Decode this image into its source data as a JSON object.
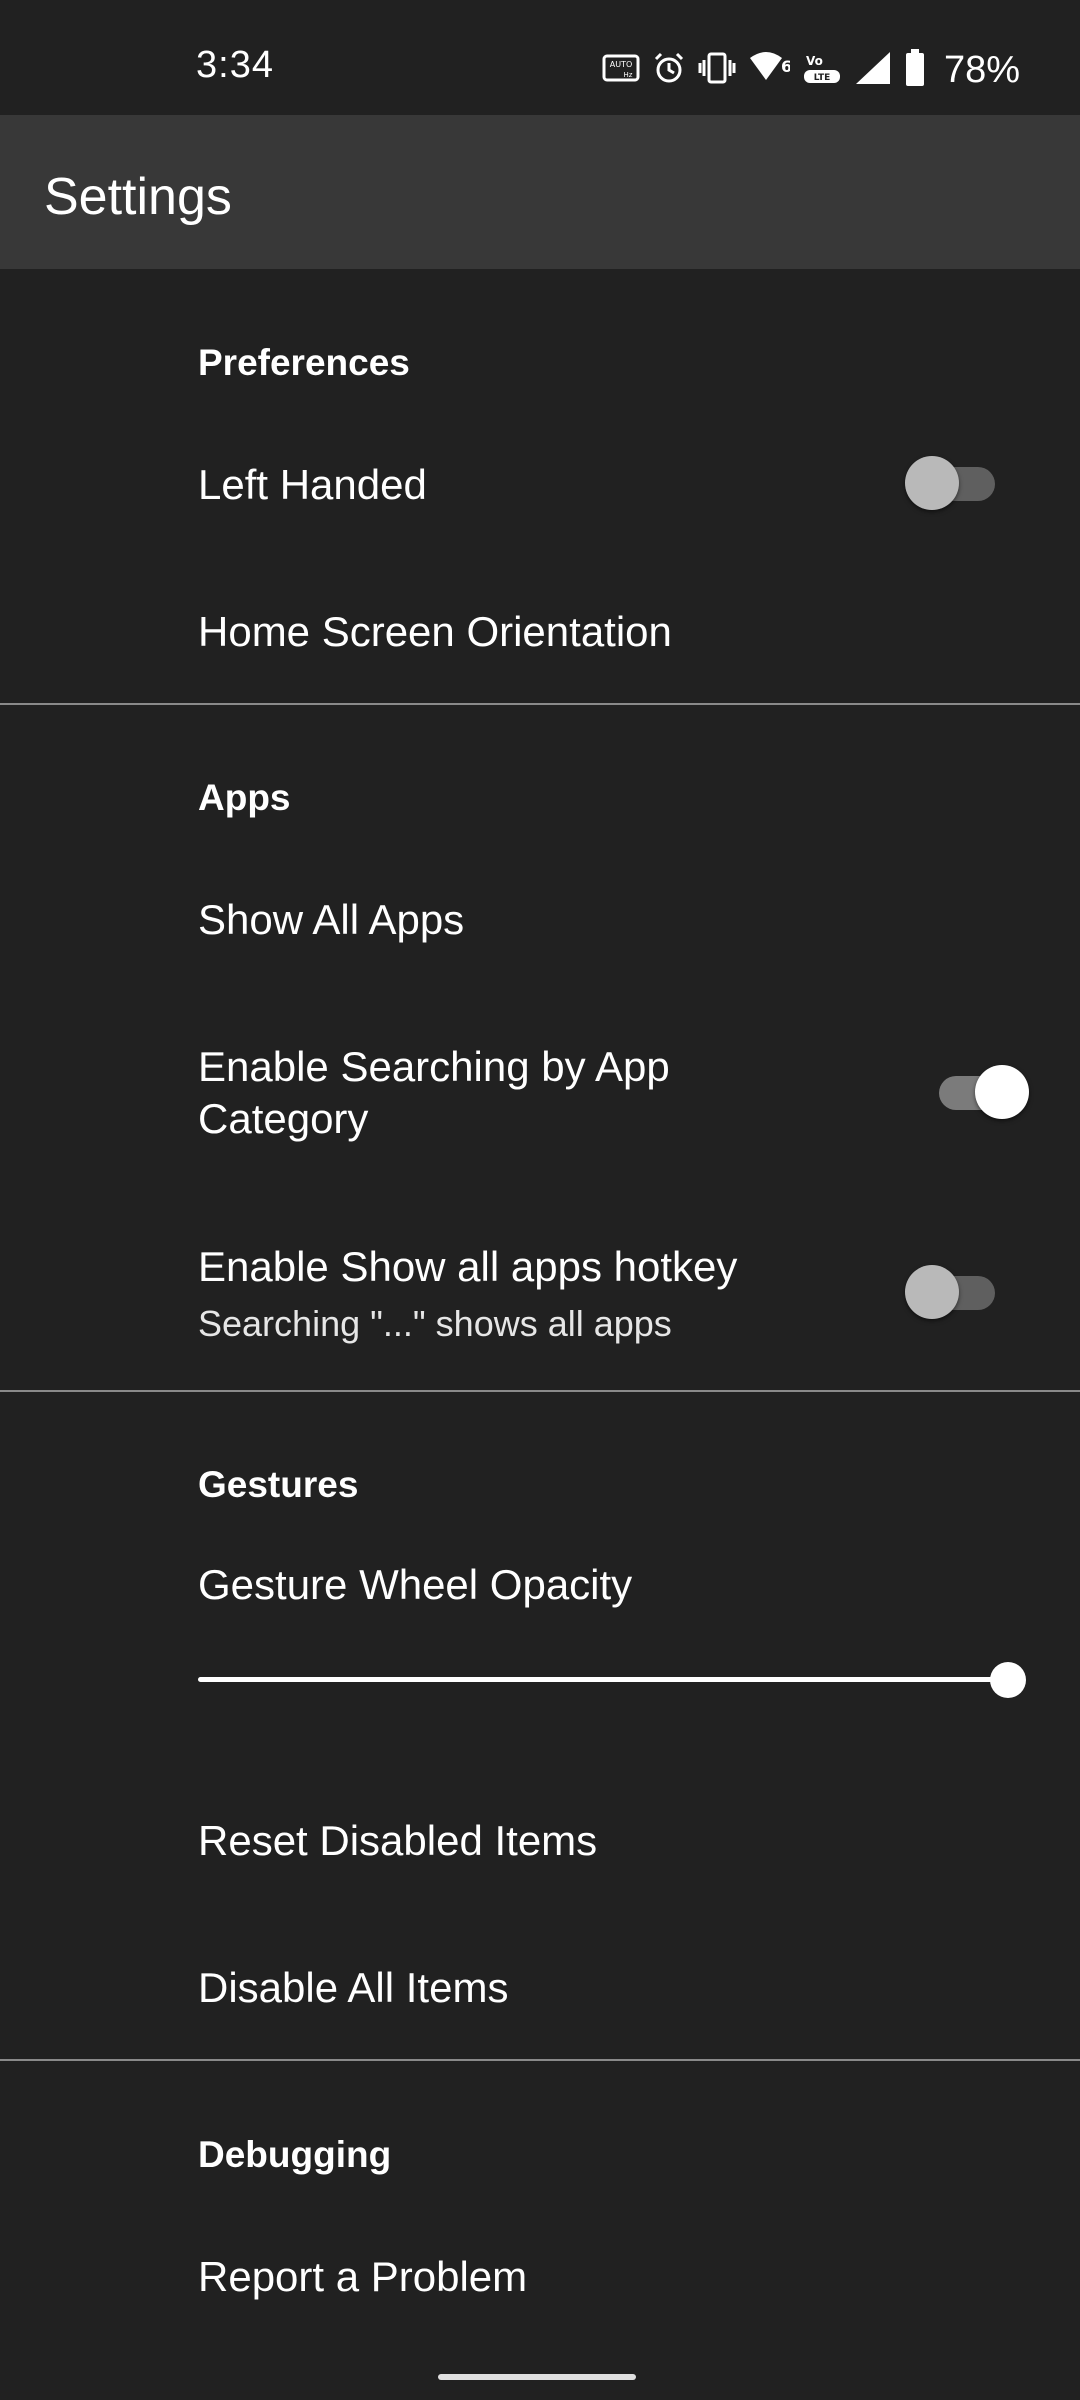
{
  "status_bar": {
    "time": "3:34",
    "battery_percent": "78%",
    "icons": [
      "auto-hz-icon",
      "alarm-icon",
      "vibrate-icon",
      "wifi-6-icon",
      "volte-icon",
      "signal-icon",
      "battery-icon"
    ]
  },
  "app_bar": {
    "title": "Settings"
  },
  "sections": {
    "preferences": {
      "header": "Preferences",
      "left_handed": {
        "title": "Left Handed",
        "checked": false
      },
      "home_screen_orientation": {
        "title": "Home Screen Orientation"
      }
    },
    "apps": {
      "header": "Apps",
      "show_all_apps": {
        "title": "Show All Apps"
      },
      "search_by_category": {
        "title": "Enable Searching by App Category",
        "checked": true
      },
      "show_all_hotkey": {
        "title": "Enable Show all apps hotkey",
        "summary": "Searching \"...\" shows all apps",
        "checked": false
      }
    },
    "gestures": {
      "header": "Gestures",
      "wheel_opacity": {
        "title": "Gesture Wheel Opacity",
        "value_fraction": 1.0
      },
      "reset_disabled": {
        "title": "Reset Disabled Items"
      },
      "disable_all": {
        "title": "Disable All Items"
      }
    },
    "debugging": {
      "header": "Debugging",
      "report_problem": {
        "title": "Report a Problem"
      }
    }
  },
  "colors": {
    "background": "#212121",
    "app_bar": "#383838",
    "divider": "#8a8a8a",
    "text": "#ffffff"
  }
}
